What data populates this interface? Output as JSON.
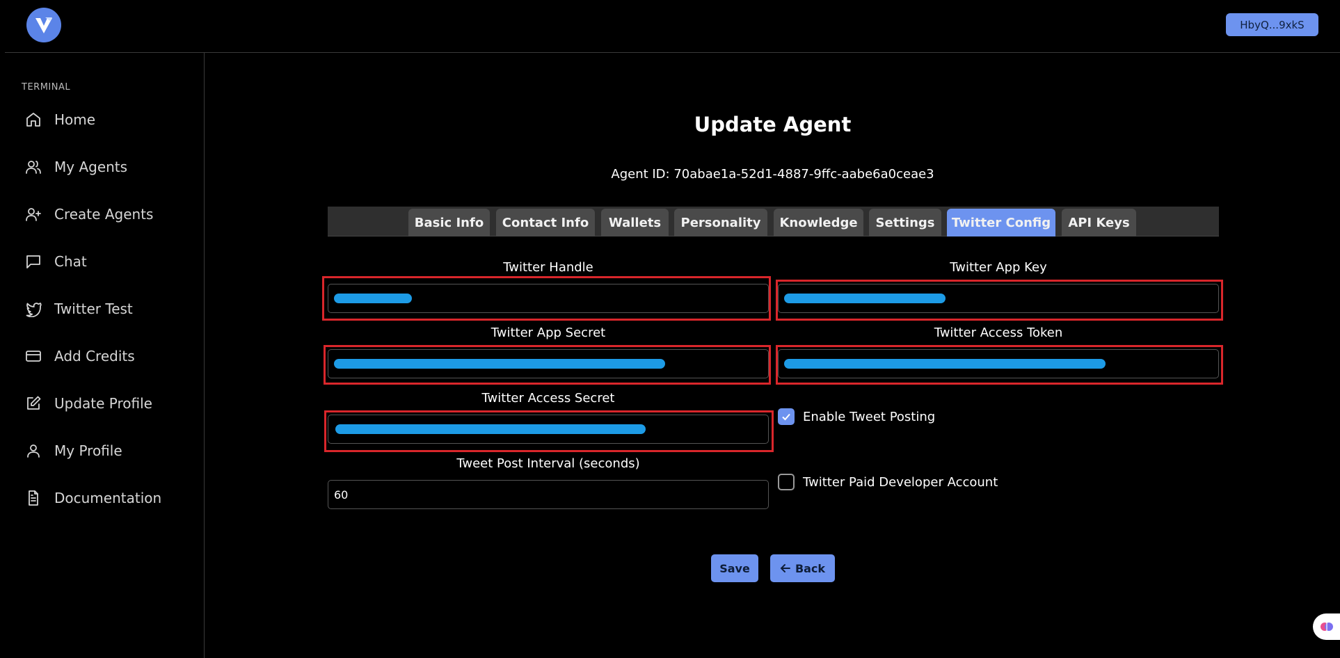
{
  "header": {
    "wallet_label": "HbyQ...9xkS"
  },
  "sidebar": {
    "heading": "TERMINAL",
    "items": [
      {
        "label": "Home",
        "icon": "home-icon"
      },
      {
        "label": "My Agents",
        "icon": "users-icon"
      },
      {
        "label": "Create Agents",
        "icon": "user-plus-icon"
      },
      {
        "label": "Chat",
        "icon": "message-square-icon"
      },
      {
        "label": "Twitter Test",
        "icon": "twitter-icon"
      },
      {
        "label": "Add Credits",
        "icon": "credit-card-icon"
      },
      {
        "label": "Update Profile",
        "icon": "edit-icon"
      },
      {
        "label": "My Profile",
        "icon": "user-icon"
      },
      {
        "label": "Documentation",
        "icon": "file-text-icon"
      }
    ]
  },
  "main": {
    "title": "Update Agent",
    "agent_id": "Agent ID: 70abae1a-52d1-4887-9ffc-aabe6a0ceae3",
    "tabs": [
      "Basic Info",
      "Contact Info",
      "Wallets",
      "Personality",
      "Knowledge",
      "Settings",
      "Twitter Config",
      "API Keys"
    ],
    "active_tab": "Twitter Config",
    "fields": {
      "twitter_handle": {
        "label": "Twitter Handle",
        "value": ""
      },
      "twitter_app_key": {
        "label": "Twitter App Key",
        "value": ""
      },
      "twitter_app_secret": {
        "label": "Twitter App Secret",
        "value": ""
      },
      "twitter_access_token": {
        "label": "Twitter Access Token",
        "value": ""
      },
      "twitter_access_secret": {
        "label": "Twitter Access Secret",
        "value": ""
      },
      "tweet_post_interval": {
        "label": "Tweet Post Interval (seconds)",
        "value": "60"
      }
    },
    "checkboxes": {
      "enable_tweet_posting": {
        "label": "Enable Tweet Posting",
        "checked": true
      },
      "paid_developer_account": {
        "label": "Twitter Paid Developer Account",
        "checked": false
      }
    },
    "buttons": {
      "save": "Save",
      "back": "Back"
    }
  },
  "colors": {
    "accent": "#6d93ef",
    "highlight_border": "#d9262b",
    "redaction": "#1d9be6"
  }
}
